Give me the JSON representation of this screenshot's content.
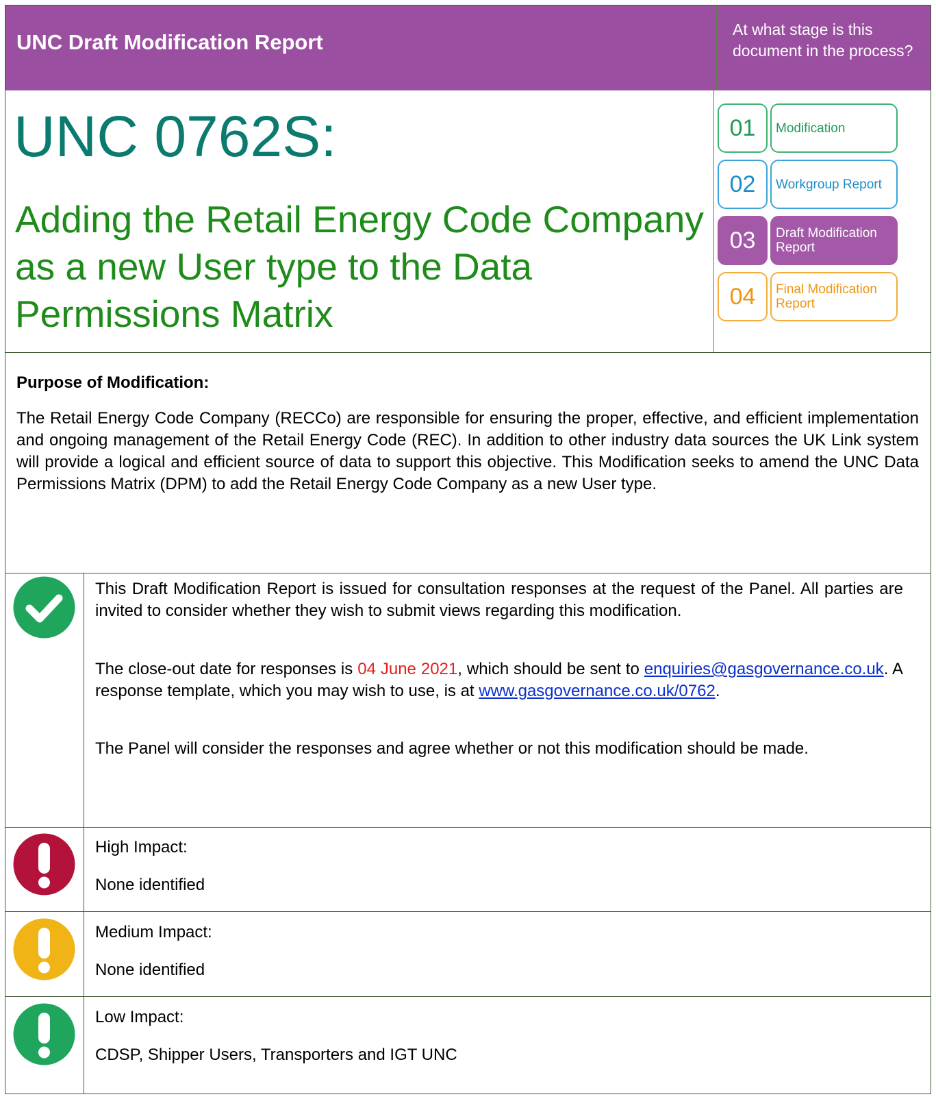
{
  "header": {
    "title": "UNC Draft Modification Report",
    "stage_question": "At what stage is this document in the process?"
  },
  "document": {
    "id": "UNC 0762S:",
    "subtitle": "Adding the Retail Energy Code Company as a new User type to the Data Permissions Matrix"
  },
  "stages": [
    {
      "number": "01",
      "label": "Modification",
      "active": false
    },
    {
      "number": "02",
      "label": "Workgroup Report",
      "active": false
    },
    {
      "number": "03",
      "label": "Draft Modification Report",
      "active": true
    },
    {
      "number": "04",
      "label": "Final Modification Report",
      "active": false
    }
  ],
  "purpose": {
    "heading": "Purpose of Modification:",
    "body": "The Retail Energy Code Company (RECCo) are responsible for ensuring the proper, effective, and efficient implementation and ongoing management of the Retail Energy Code (REC).  In addition to other industry data sources the UK Link system will provide a logical and efficient source of data to support this objective.  This Modification seeks to amend the UNC Data Permissions Matrix (DPM) to add the Retail Energy Code Company as a new User type."
  },
  "notice": {
    "icon": "check-icon",
    "para1": "This Draft Modification Report is issued for consultation responses at the request of the Panel. All parties are invited to consider whether they wish to submit views regarding this modification.",
    "para2_a": "The close-out date for responses is ",
    "close_date": "04 June 2021",
    "para2_b": ", which should be sent to ",
    "email": "enquiries@gasgovernance.co.uk",
    "para2_c": ".  A response template, which you may wish to use, is at ",
    "template_url": "www.gasgovernance.co.uk/0762",
    "para2_d": ".",
    "para3": "The Panel will consider the responses and agree whether or not this modification should be made."
  },
  "impacts": [
    {
      "label": "High Impact:",
      "value": "None identified",
      "color": "#b3133a",
      "icon": "exclamation-icon"
    },
    {
      "label": "Medium Impact:",
      "value": "None identified",
      "color": "#f0b416",
      "icon": "exclamation-icon"
    },
    {
      "label": "Low Impact:",
      "value": "CDSP, Shipper Users, Transporters and IGT UNC",
      "color": "#1fa65c",
      "icon": "exclamation-icon"
    }
  ],
  "colors": {
    "header_bg": "#9b4fa0",
    "doc_id": "#0b7a6f",
    "subtitle": "#1f8b1a",
    "check_icon": "#1fa65c",
    "date": "#e51d1d"
  }
}
